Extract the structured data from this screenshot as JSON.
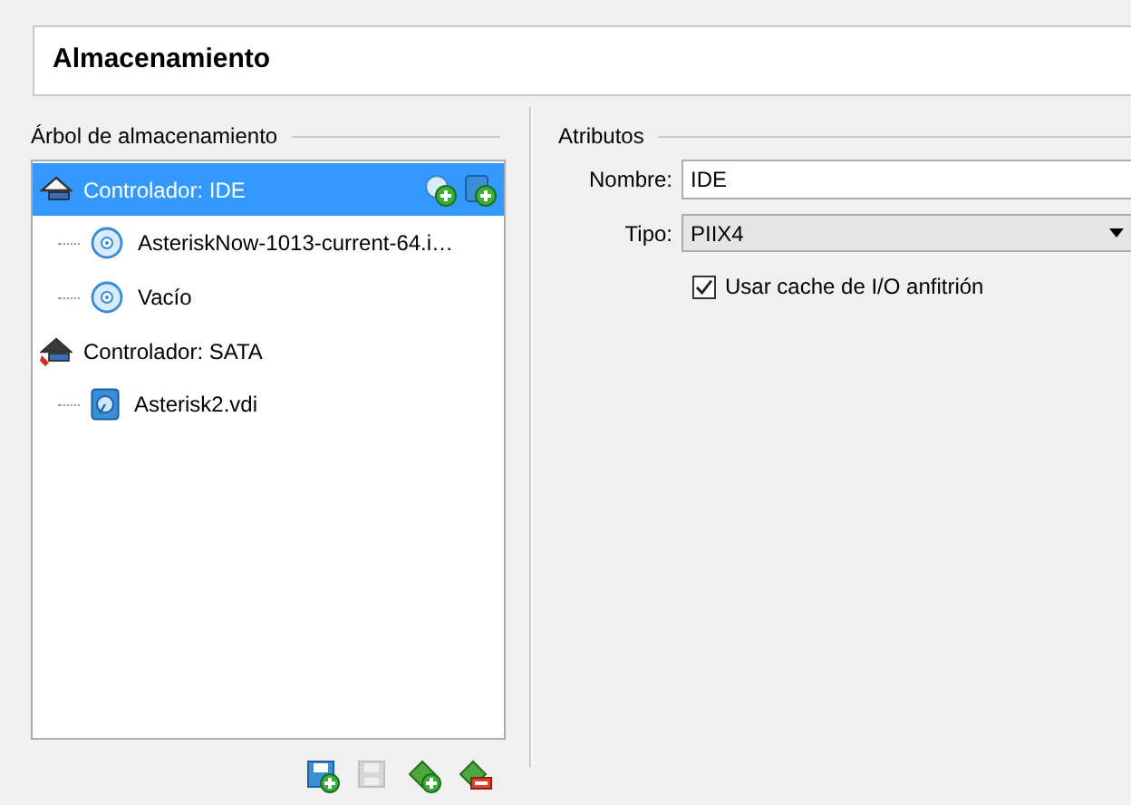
{
  "header": {
    "title": "Almacenamiento"
  },
  "tree_group": {
    "title": "Árbol de almacenamiento"
  },
  "tree": [
    {
      "kind": "ide_controller",
      "label": "Controlador: IDE",
      "selected": true,
      "children": [
        {
          "kind": "optical",
          "label": "AsteriskNow-1013-current-64.i…",
          "selected": false
        },
        {
          "kind": "optical",
          "label": "Vacío",
          "selected": false
        }
      ]
    },
    {
      "kind": "sata_controller",
      "label": "Controlador: SATA",
      "selected": false,
      "children": [
        {
          "kind": "hard_disk",
          "label": "Asterisk2.vdi",
          "selected": false
        }
      ]
    }
  ],
  "tree_toolbar": [
    {
      "kind": "add_controller",
      "disabled": false
    },
    {
      "kind": "remove_controller",
      "disabled": true
    },
    {
      "kind": "add_attachment",
      "disabled": false
    },
    {
      "kind": "remove_attachment",
      "disabled": false
    }
  ],
  "attributes": {
    "title": "Atributos",
    "name_label": "Nombre:",
    "name_value": "IDE",
    "type_label": "Tipo:",
    "type_value": "PIIX4",
    "cache_label": "Usar cache de I/O anfitrión",
    "cache_checked": true
  }
}
